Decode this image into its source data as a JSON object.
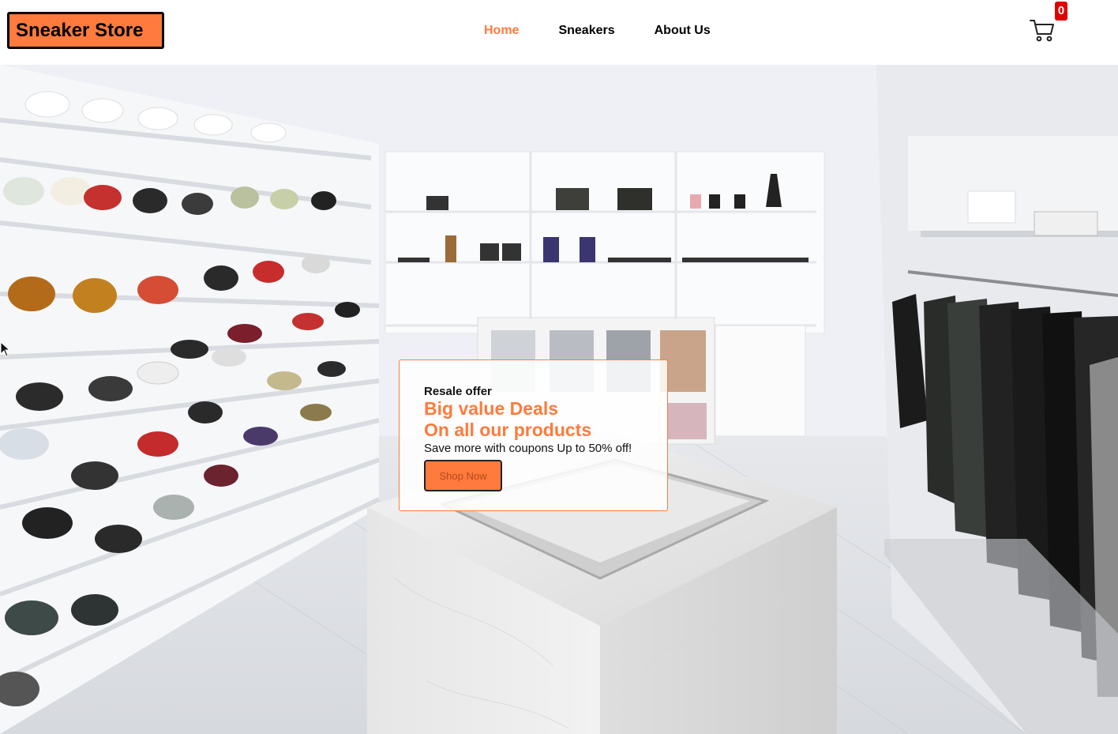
{
  "header": {
    "logo": "Sneaker Store",
    "nav": [
      {
        "label": "Home",
        "active": true
      },
      {
        "label": "Sneakers",
        "active": false
      },
      {
        "label": "About Us",
        "active": false
      }
    ],
    "cart_icon": "cart-icon",
    "cart_count": "0"
  },
  "hero": {
    "background": "sneaker-store-interior-photo",
    "offer": {
      "kicker": "Resale offer",
      "headline_line1": "Big value Deals",
      "headline_line2": "On all our products",
      "subtext": "Save more with coupons Up to 50% off!",
      "cta_label": "Shop Now"
    }
  },
  "colors": {
    "accent": "#ff7a3d",
    "badge": "#e00000",
    "text": "#000000"
  }
}
